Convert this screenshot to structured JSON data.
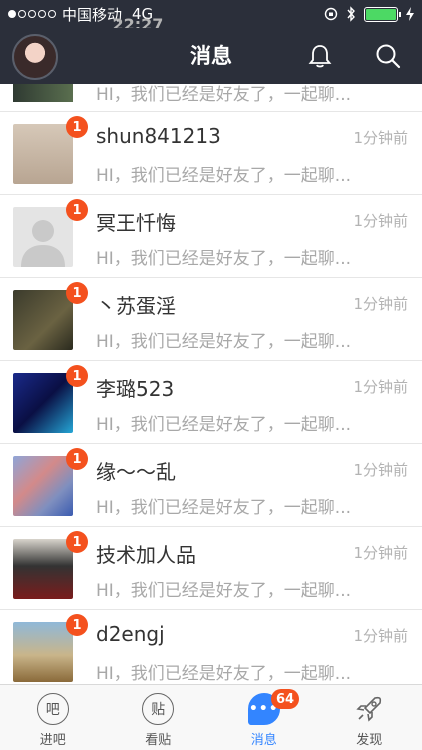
{
  "status": {
    "carrier": "中国移动",
    "network": "4G",
    "time": "22:27"
  },
  "header": {
    "title": "消息"
  },
  "list": {
    "partial_message": "HI，我们已经是好友了，一起聊...",
    "items": [
      {
        "name": "shun841213",
        "time": "1分钟前",
        "message": "HI，我们已经是好友了，一起聊...",
        "badge": "1"
      },
      {
        "name": "冥王忏悔",
        "time": "1分钟前",
        "message": "HI，我们已经是好友了，一起聊...",
        "badge": "1"
      },
      {
        "name": "丶苏蛋淫",
        "time": "1分钟前",
        "message": "HI，我们已经是好友了，一起聊...",
        "badge": "1"
      },
      {
        "name": "李璐523",
        "time": "1分钟前",
        "message": "HI，我们已经是好友了，一起聊...",
        "badge": "1"
      },
      {
        "name": "缘～～乱",
        "time": "1分钟前",
        "message": "HI，我们已经是好友了，一起聊...",
        "badge": "1"
      },
      {
        "name": "技术加人品",
        "time": "1分钟前",
        "message": "HI，我们已经是好友了，一起聊...",
        "badge": "1"
      },
      {
        "name": "d2engj",
        "time": "1分钟前",
        "message": "HI，我们已经是好友了，一起聊...",
        "badge": "1"
      }
    ]
  },
  "tabbar": {
    "tabs": [
      {
        "label": "进吧",
        "icon_text": "吧"
      },
      {
        "label": "看贴",
        "icon_text": "贴"
      },
      {
        "label": "消息",
        "icon_text": "•••",
        "badge": "64"
      },
      {
        "label": "发现"
      }
    ]
  },
  "colors": {
    "header_bg": "#2b2f3a",
    "badge": "#f4511e",
    "active_tab": "#3385ff"
  }
}
